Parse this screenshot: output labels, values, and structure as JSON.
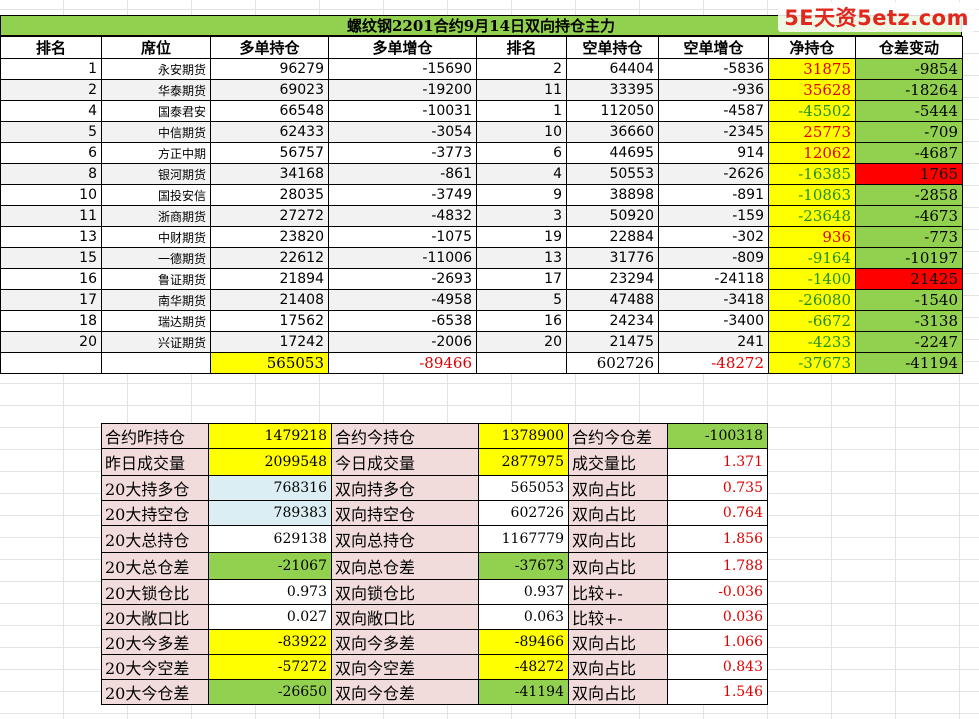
{
  "watermark": "5E天资5etz.com",
  "title": "螺纹钢2201合约9月14日双向持仓主力",
  "headers": [
    "排名",
    "席位",
    "多单持仓",
    "多单增仓",
    "排名",
    "空单持仓",
    "空单增仓",
    "净持仓",
    "仓差变动"
  ],
  "rows": [
    {
      "rank_long": "1",
      "broker": "永安期货",
      "long": "96279",
      "long_chg": "-15690",
      "rank_short": "2",
      "short": "64404",
      "short_chg": "-5836",
      "net": "31875",
      "diff": "-9854"
    },
    {
      "rank_long": "2",
      "broker": "华泰期货",
      "long": "69023",
      "long_chg": "-19200",
      "rank_short": "11",
      "short": "33395",
      "short_chg": "-936",
      "net": "35628",
      "diff": "-18264"
    },
    {
      "rank_long": "4",
      "broker": "国泰君安",
      "long": "66548",
      "long_chg": "-10031",
      "rank_short": "1",
      "short": "112050",
      "short_chg": "-4587",
      "net": "-45502",
      "diff": "-5444"
    },
    {
      "rank_long": "5",
      "broker": "中信期货",
      "long": "62433",
      "long_chg": "-3054",
      "rank_short": "10",
      "short": "36660",
      "short_chg": "-2345",
      "net": "25773",
      "diff": "-709"
    },
    {
      "rank_long": "6",
      "broker": "方正中期",
      "long": "56757",
      "long_chg": "-3773",
      "rank_short": "6",
      "short": "44695",
      "short_chg": "914",
      "net": "12062",
      "diff": "-4687"
    },
    {
      "rank_long": "8",
      "broker": "银河期货",
      "long": "34168",
      "long_chg": "-861",
      "rank_short": "4",
      "short": "50553",
      "short_chg": "-2626",
      "net": "-16385",
      "diff": "1765"
    },
    {
      "rank_long": "10",
      "broker": "国投安信",
      "long": "28035",
      "long_chg": "-3749",
      "rank_short": "9",
      "short": "38898",
      "short_chg": "-891",
      "net": "-10863",
      "diff": "-2858"
    },
    {
      "rank_long": "11",
      "broker": "浙商期货",
      "long": "27272",
      "long_chg": "-4832",
      "rank_short": "3",
      "short": "50920",
      "short_chg": "-159",
      "net": "-23648",
      "diff": "-4673"
    },
    {
      "rank_long": "13",
      "broker": "中财期货",
      "long": "23820",
      "long_chg": "-1075",
      "rank_short": "19",
      "short": "22884",
      "short_chg": "-302",
      "net": "936",
      "diff": "-773"
    },
    {
      "rank_long": "15",
      "broker": "一德期货",
      "long": "22612",
      "long_chg": "-11006",
      "rank_short": "13",
      "short": "31776",
      "short_chg": "-809",
      "net": "-9164",
      "diff": "-10197"
    },
    {
      "rank_long": "16",
      "broker": "鲁证期货",
      "long": "21894",
      "long_chg": "-2693",
      "rank_short": "17",
      "short": "23294",
      "short_chg": "-24118",
      "net": "-1400",
      "diff": "21425"
    },
    {
      "rank_long": "17",
      "broker": "南华期货",
      "long": "21408",
      "long_chg": "-4958",
      "rank_short": "5",
      "short": "47488",
      "short_chg": "-3418",
      "net": "-26080",
      "diff": "-1540"
    },
    {
      "rank_long": "18",
      "broker": "瑞达期货",
      "long": "17562",
      "long_chg": "-6538",
      "rank_short": "16",
      "short": "24234",
      "short_chg": "-3400",
      "net": "-6672",
      "diff": "-3138"
    },
    {
      "rank_long": "20",
      "broker": "兴证期货",
      "long": "17242",
      "long_chg": "-2006",
      "rank_short": "20",
      "short": "21475",
      "short_chg": "241",
      "net": "-4233",
      "diff": "-2247"
    }
  ],
  "totals": {
    "long": "565053",
    "long_chg": "-89466",
    "short": "602726",
    "short_chg": "-48272",
    "net": "-37673",
    "diff": "-41194"
  },
  "summary": [
    {
      "l1": "合约昨持仓",
      "v1": "1479218",
      "l2": "合约今持仓",
      "v2": "1378900",
      "l3": "合约今仓差",
      "v3": "-100318"
    },
    {
      "l1": "昨日成交量",
      "v1": "2099548",
      "l2": "今日成交量",
      "v2": "2877975",
      "l3": "成交量比",
      "v3": "1.371"
    },
    {
      "l1": "20大持多仓",
      "v1": "768316",
      "l2": "双向持多仓",
      "v2": "565053",
      "l3": "双向占比",
      "v3": "0.735"
    },
    {
      "l1": "20大持空仓",
      "v1": "789383",
      "l2": "双向持空仓",
      "v2": "602726",
      "l3": "双向占比",
      "v3": "0.764"
    },
    {
      "l1": "20大总持仓",
      "v1": "629138",
      "l2": "双向总持仓",
      "v2": "1167779",
      "l3": "双向占比",
      "v3": "1.856"
    },
    {
      "l1": "20大总仓差",
      "v1": "-21067",
      "l2": "双向总仓差",
      "v2": "-37673",
      "l3": "双向占比",
      "v3": "1.788"
    },
    {
      "l1": "20大锁仓比",
      "v1": "0.973",
      "l2": "双向锁仓比",
      "v2": "0.937",
      "l3": "比较+-",
      "v3": "-0.036"
    },
    {
      "l1": "20大敞口比",
      "v1": "0.027",
      "l2": "双向敞口比",
      "v2": "0.063",
      "l3": "比较+-",
      "v3": "0.036"
    },
    {
      "l1": "20大今多差",
      "v1": "-83922",
      "l2": "双向今多差",
      "v2": "-89466",
      "l3": "双向占比",
      "v3": "1.066"
    },
    {
      "l1": "20大今空差",
      "v1": "-57272",
      "l2": "双向今空差",
      "v2": "-48272",
      "l3": "双向占比",
      "v3": "0.843"
    },
    {
      "l1": "20大今仓差",
      "v1": "-26650",
      "l2": "双向今仓差",
      "v2": "-41194",
      "l3": "双向占比",
      "v3": "1.546"
    }
  ],
  "colors": {
    "header_green": "#92d050",
    "highlight_yellow": "#ffff00",
    "highlight_red": "#ff0000",
    "label_pink": "#f2dcdb",
    "light_blue": "#daeef3",
    "text_red": "#e00000",
    "text_green": "#1f8f1f"
  }
}
